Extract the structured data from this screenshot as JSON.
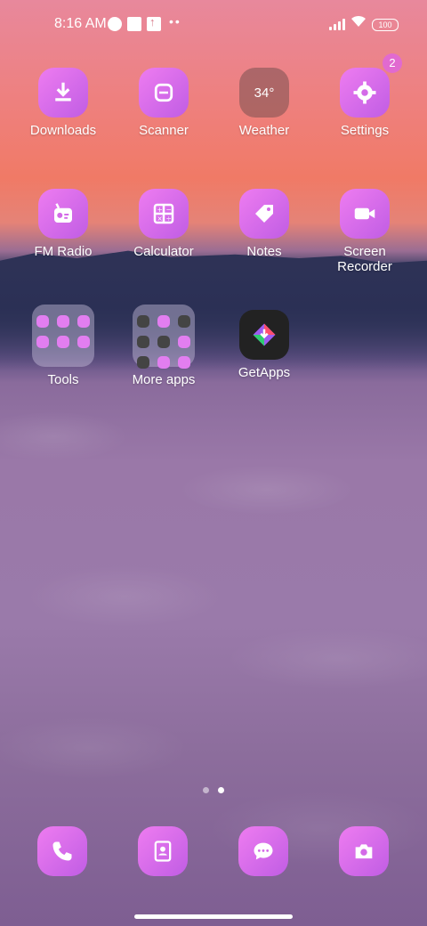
{
  "status_bar": {
    "time": "8:16 AM",
    "battery": "100"
  },
  "apps": {
    "downloads": "Downloads",
    "scanner": "Scanner",
    "weather": "Weather",
    "weather_temp": "34°",
    "settings": "Settings",
    "settings_badge": "2",
    "fm_radio": "FM Radio",
    "calculator": "Calculator",
    "notes": "Notes",
    "screen_recorder": "Screen Recorder",
    "tools": "Tools",
    "more_apps": "More apps",
    "getapps": "GetApps"
  },
  "dock": [
    "phone-icon",
    "contacts-icon",
    "messages-icon",
    "camera-icon"
  ],
  "colors": {
    "icon_gradient_start": "#ee7cf0",
    "icon_gradient_end": "#c05de4",
    "badge": "#e16ad0"
  },
  "page_indicator": {
    "pages": 2,
    "active": 2
  }
}
